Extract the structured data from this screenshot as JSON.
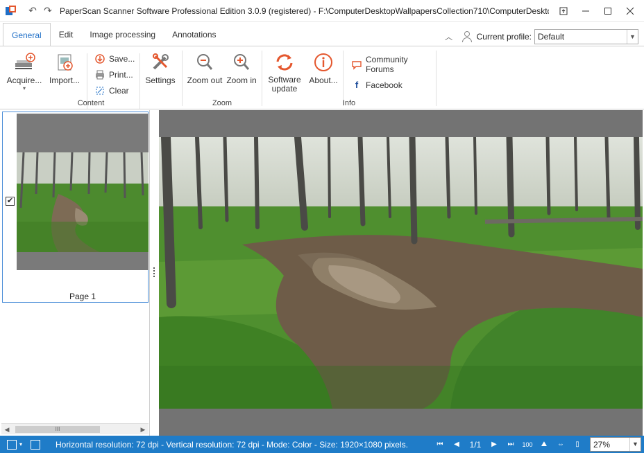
{
  "window": {
    "title": "PaperScan Scanner Software Professional Edition 3.0.9 (registered) - F:\\ComputerDesktopWallpapersCollection710\\ComputerDesktopWallpapersC..."
  },
  "ribbon_tabs": [
    "General",
    "Edit",
    "Image processing",
    "Annotations"
  ],
  "profile": {
    "label": "Current profile:",
    "value": "Default"
  },
  "groups": {
    "content": {
      "label": "Content",
      "acquire": "Acquire...",
      "import": "Import...",
      "save": "Save...",
      "print": "Print...",
      "clear": "Clear",
      "settings": "Settings"
    },
    "zoom": {
      "label": "Zoom",
      "zoom_out": "Zoom out",
      "zoom_in": "Zoom in"
    },
    "info": {
      "label": "Info",
      "software_update_1": "Software",
      "software_update_2": "update",
      "about": "About...",
      "community": "Community Forums",
      "facebook": "Facebook"
    }
  },
  "thumbnails": [
    {
      "label": "Page 1",
      "checked": true
    }
  ],
  "statusbar": {
    "info": "Horizontal resolution:  72 dpi - Vertical resolution:  72 dpi - Mode: Color - Size: 1920×1080 pixels.",
    "page": "1/1",
    "zoom": "27%"
  },
  "colors": {
    "accent": "#1f7cc8",
    "tab_active": "#1f6fc7",
    "viewer_bg": "#737373"
  }
}
